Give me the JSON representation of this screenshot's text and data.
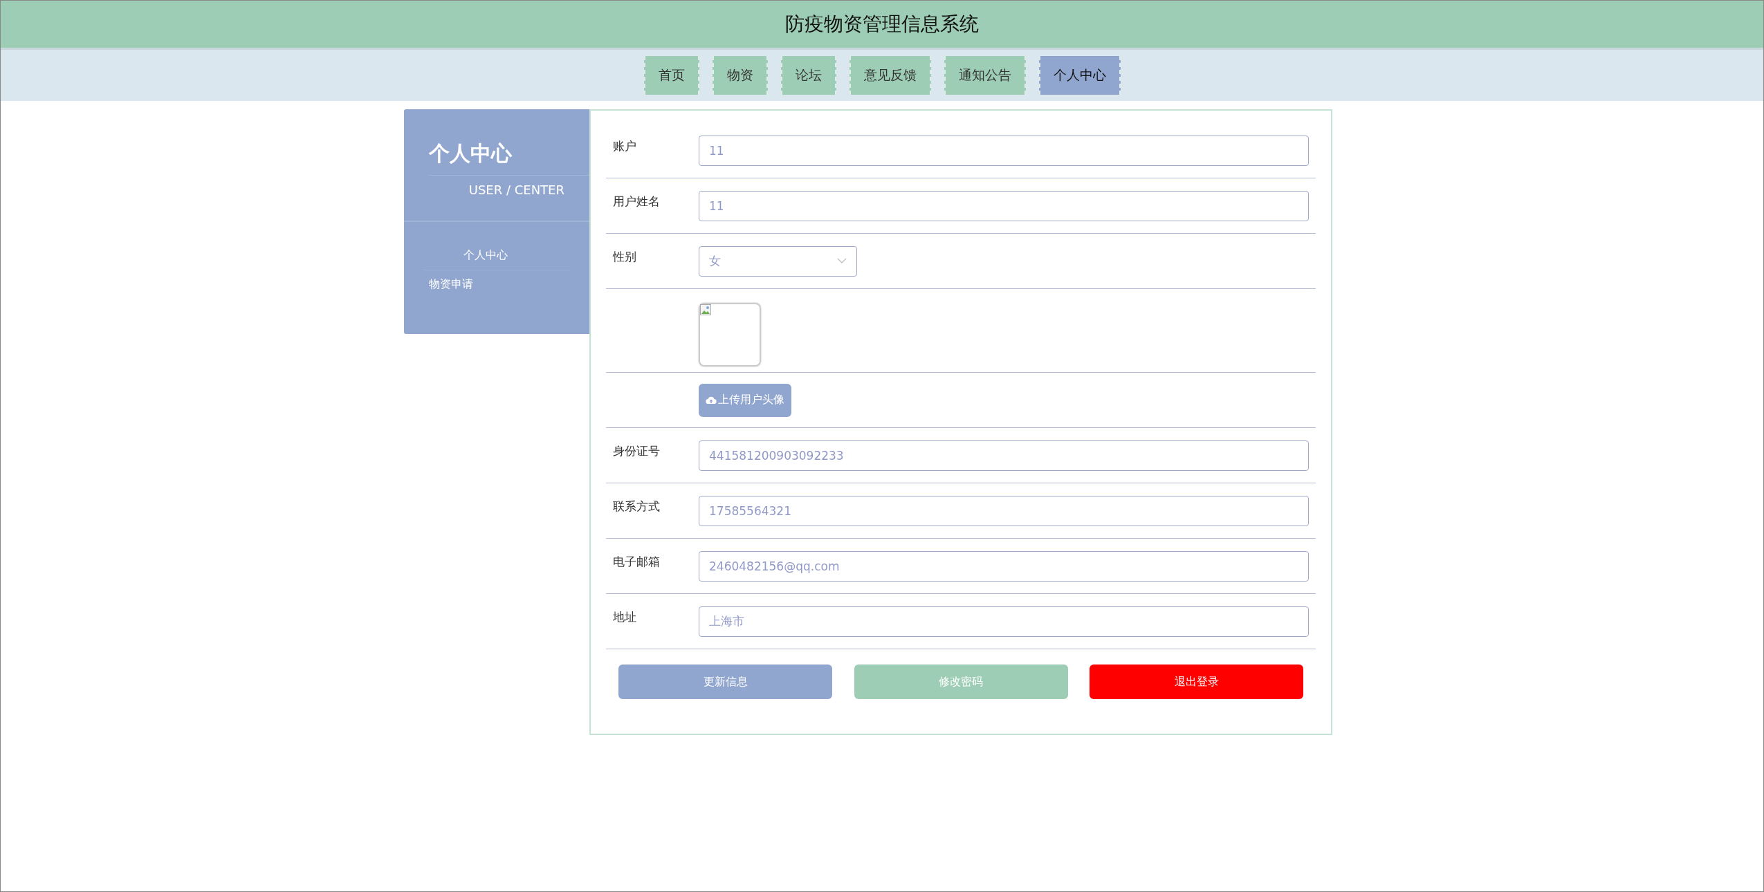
{
  "header": {
    "title": "防疫物资管理信息系统"
  },
  "nav": [
    {
      "label": "首页",
      "selected": false
    },
    {
      "label": "物资",
      "selected": false
    },
    {
      "label": "论坛",
      "selected": false
    },
    {
      "label": "意见反馈",
      "selected": false
    },
    {
      "label": "通知公告",
      "selected": false
    },
    {
      "label": "个人中心",
      "selected": true
    }
  ],
  "sidebar": {
    "title": "个人中心",
    "subtitle": "USER / CENTER",
    "items": [
      {
        "label": "个人中心",
        "selected": true
      },
      {
        "label": "物资申请",
        "selected": false
      }
    ]
  },
  "form": {
    "rows": [
      {
        "kind": "text",
        "label": "账户",
        "value": "11"
      },
      {
        "kind": "text",
        "label": "用户姓名",
        "value": "11"
      },
      {
        "kind": "select",
        "label": "性别",
        "value": "女"
      },
      {
        "kind": "image"
      },
      {
        "kind": "upload",
        "button": "上传用户头像"
      },
      {
        "kind": "text",
        "label": "身份证号",
        "value": "441581200903092233"
      },
      {
        "kind": "text",
        "label": "联系方式",
        "value": "17585564321"
      },
      {
        "kind": "text",
        "label": "电子邮箱",
        "value": "2460482156@qq.com"
      },
      {
        "kind": "text",
        "label": "地址",
        "value": "上海市"
      }
    ],
    "buttons": [
      {
        "label": "更新信息",
        "color": "#91a6cf"
      },
      {
        "label": "修改密码",
        "color": "#9ecdb5"
      },
      {
        "label": "退出登录",
        "color": "#ff0000"
      }
    ]
  }
}
